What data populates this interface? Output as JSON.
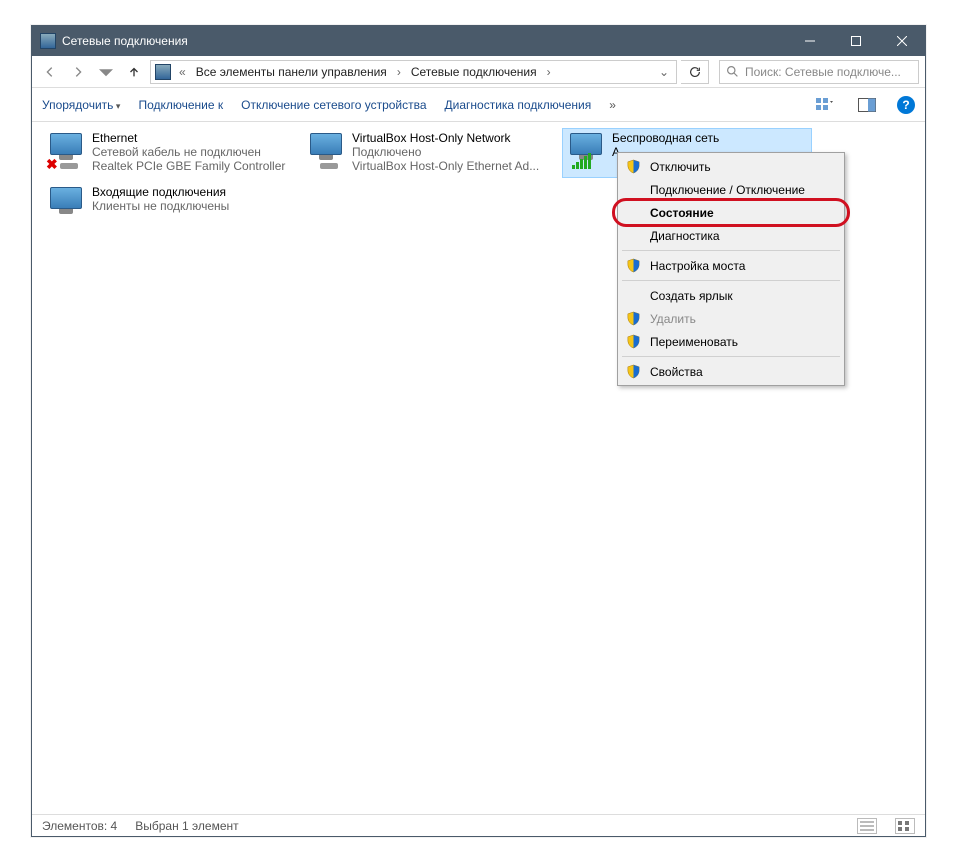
{
  "titlebar": {
    "title": "Сетевые подключения"
  },
  "breadcrumb": {
    "item1": "Все элементы панели управления",
    "item2": "Сетевые подключения"
  },
  "search": {
    "placeholder": "Поиск: Сетевые подключе..."
  },
  "toolbar": {
    "organize": "Упорядочить",
    "connect_to": "Подключение к",
    "disable_device": "Отключение сетевого устройства",
    "diagnose": "Диагностика подключения",
    "more": "»"
  },
  "items": [
    {
      "name": "Ethernet",
      "status": "Сетевой кабель не подключен",
      "device": "Realtek PCIe GBE Family Controller"
    },
    {
      "name": "VirtualBox Host-Only Network",
      "status": "Подключено",
      "device": "VirtualBox Host-Only Ethernet Ad..."
    },
    {
      "name": "Беспроводная сеть",
      "status": "",
      "device": "A"
    },
    {
      "name": "Входящие подключения",
      "status": "Клиенты не подключены",
      "device": ""
    }
  ],
  "contextmenu": {
    "disable": "Отключить",
    "connect_disconnect": "Подключение / Отключение",
    "status": "Состояние",
    "diagnose": "Диагностика",
    "bridge": "Настройка моста",
    "shortcut": "Создать ярлык",
    "delete": "Удалить",
    "rename": "Переименовать",
    "properties": "Свойства"
  },
  "statusbar": {
    "count": "Элементов: 4",
    "selected": "Выбран 1 элемент"
  }
}
